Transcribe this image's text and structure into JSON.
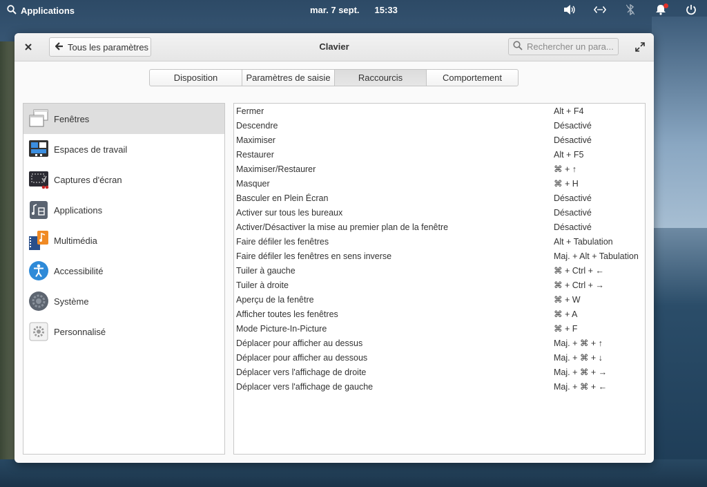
{
  "panel": {
    "applications_label": "Applications",
    "date": "mar. 7 sept.",
    "time": "15:33"
  },
  "window": {
    "title": "Clavier",
    "back_label": "Tous les paramètres",
    "search_placeholder": "Rechercher un para..."
  },
  "tabs": [
    {
      "label": "Disposition"
    },
    {
      "label": "Paramètres de saisie"
    },
    {
      "label": "Raccourcis"
    },
    {
      "label": "Comportement"
    }
  ],
  "sidebar": {
    "items": [
      {
        "label": "Fenêtres",
        "icon": "windows-icon"
      },
      {
        "label": "Espaces de travail",
        "icon": "workspaces-icon"
      },
      {
        "label": "Captures d'écran",
        "icon": "screenshot-icon"
      },
      {
        "label": "Applications",
        "icon": "applications-icon"
      },
      {
        "label": "Multimédia",
        "icon": "multimedia-icon"
      },
      {
        "label": "Accessibilité",
        "icon": "accessibility-icon"
      },
      {
        "label": "Système",
        "icon": "system-gear-icon"
      },
      {
        "label": "Personnalisé",
        "icon": "custom-gear-icon"
      }
    ]
  },
  "shortcuts": [
    {
      "name": "Fermer",
      "accel": "Alt + F4"
    },
    {
      "name": "Descendre",
      "accel": "Désactivé"
    },
    {
      "name": "Maximiser",
      "accel": "Désactivé"
    },
    {
      "name": "Restaurer",
      "accel": "Alt + F5"
    },
    {
      "name": "Maximiser/Restaurer",
      "accel": "⌘ + ↑"
    },
    {
      "name": "Masquer",
      "accel": "⌘ + H"
    },
    {
      "name": "Basculer en Plein Écran",
      "accel": "Désactivé"
    },
    {
      "name": "Activer sur tous les bureaux",
      "accel": "Désactivé"
    },
    {
      "name": "Activer/Désactiver la mise au premier plan de la fenêtre",
      "accel": "Désactivé"
    },
    {
      "name": "Faire défiler les fenêtres",
      "accel": "Alt + Tabulation"
    },
    {
      "name": "Faire défiler les fenêtres en sens inverse",
      "accel": "Maj. + Alt + Tabulation"
    },
    {
      "name": "Tuiler à gauche",
      "accel": "⌘ + Ctrl + ←"
    },
    {
      "name": "Tuiler à droite",
      "accel": "⌘ + Ctrl + →"
    },
    {
      "name": "Aperçu de la fenêtre",
      "accel": "⌘ + W"
    },
    {
      "name": "Afficher toutes les fenêtres",
      "accel": "⌘ + A"
    },
    {
      "name": "Mode Picture-In-Picture",
      "accel": "⌘ + F"
    },
    {
      "name": "Déplacer pour afficher au dessus",
      "accel": "Maj. + ⌘ + ↑"
    },
    {
      "name": "Déplacer pour afficher au dessous",
      "accel": "Maj. + ⌘ + ↓"
    },
    {
      "name": "Déplacer vers l'affichage de droite",
      "accel": "Maj. + ⌘ + →"
    },
    {
      "name": "Déplacer vers l'affichage de gauche",
      "accel": "Maj. + ⌘ + ←"
    }
  ],
  "colors": {
    "selected_row": "#dedede",
    "notification_dot": "#e0312a",
    "accessibility_blue": "#2e8ad8"
  }
}
